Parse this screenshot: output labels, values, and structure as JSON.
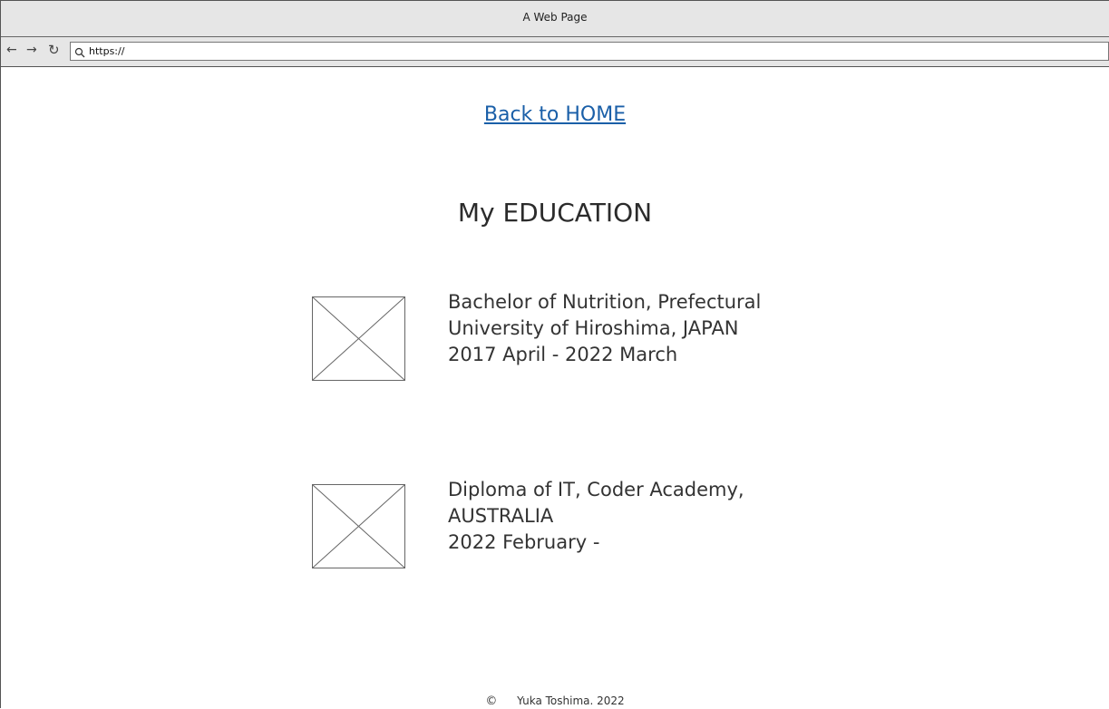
{
  "browser": {
    "window_title": "A Web Page",
    "url": "https://",
    "nav": {
      "back": "←",
      "forward": "→",
      "reload": "↻"
    }
  },
  "page": {
    "back_link": "Back to HOME",
    "title": "My EDUCATION",
    "education": [
      {
        "line1": "Bachelor of Nutrition, Prefectural",
        "line2": "University of Hiroshima, JAPAN",
        "line3": "2017 April - 2022 March"
      },
      {
        "line1": "Diploma of IT, Coder Academy,",
        "line2": "AUSTRALIA",
        "line3": "2022 February -"
      }
    ],
    "footer": {
      "copyright_symbol": "©",
      "text": "Yuka Toshima. 2022"
    }
  },
  "colors": {
    "link": "#1a5fa8",
    "chrome": "#e6e6e6",
    "text": "#333333"
  }
}
